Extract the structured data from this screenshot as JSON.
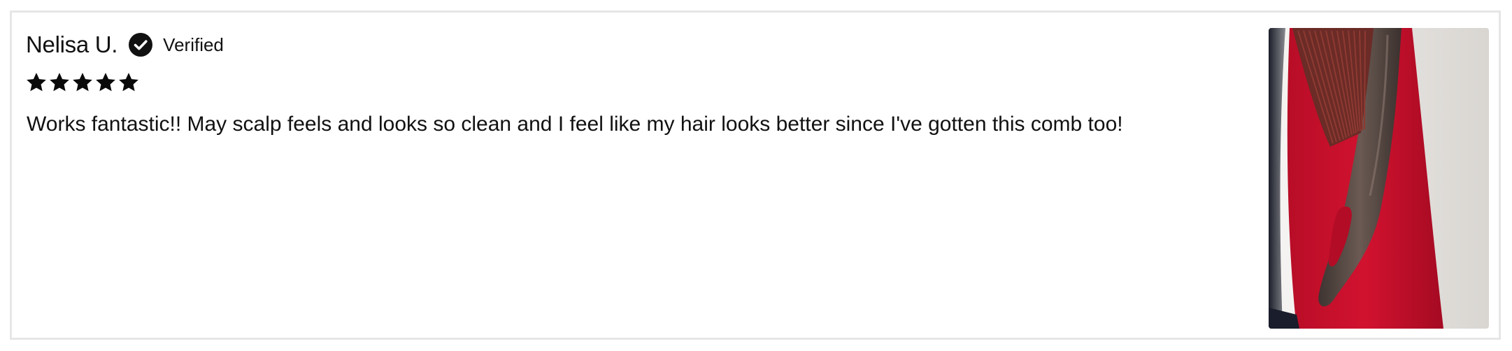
{
  "review": {
    "reviewer_name": "Nelisa U.",
    "verified_label": "Verified",
    "rating": 5,
    "rating_max": 5,
    "stars": [
      {
        "icon": "star-filled-icon"
      },
      {
        "icon": "star-filled-icon"
      },
      {
        "icon": "star-filled-icon"
      },
      {
        "icon": "star-filled-icon"
      },
      {
        "icon": "star-filled-icon"
      }
    ],
    "body": "Works fantastic!! May scalp feels and looks so clean and I feel like my hair looks better since I've gotten this comb too!",
    "verified_icon": "check-circle-icon",
    "photo_icon": "comb-photo"
  },
  "colors": {
    "text": "#111111",
    "card_border": "#e6e6e6",
    "star": "#0a0a0a",
    "photo_red": "#c8102e",
    "photo_white": "#e9e7e4",
    "photo_comb": "#5a4a44"
  }
}
